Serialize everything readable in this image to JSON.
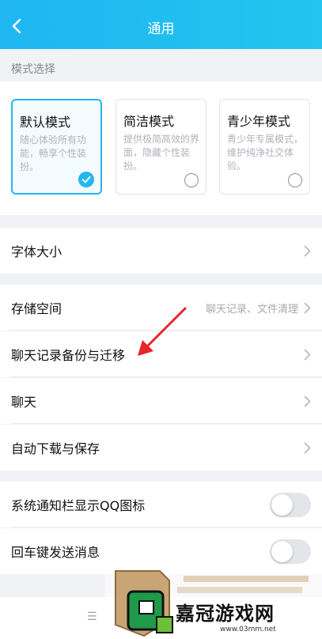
{
  "header": {
    "title": "通用"
  },
  "mode_section": {
    "label": "模式选择",
    "cards": [
      {
        "title": "默认模式",
        "desc": "随心体验所有功能，畅享个性装扮。",
        "selected": true
      },
      {
        "title": "简洁模式",
        "desc": "提供极简高效的界面，隐藏个性装扮。",
        "selected": false
      },
      {
        "title": "青少年模式",
        "desc": "青少年专属模式，维护纯净社交体验。",
        "selected": false
      }
    ]
  },
  "rows": {
    "font_size": "字体大小",
    "storage": "存储空间",
    "storage_sub": "聊天记录、文件清理",
    "chat_backup": "聊天记录备份与迁移",
    "chat": "聊天",
    "auto_download": "自动下载与保存",
    "notif_qq_icon": "系统通知栏显示QQ图标",
    "enter_send": "回车键发送消息"
  },
  "toggles": {
    "notif_qq_icon": false,
    "enter_send": false
  },
  "watermark": {
    "text": "嘉冠游戏网",
    "url": "www.03mm.net"
  },
  "colors": {
    "accent": "#23b7ef",
    "arrow": "#e8232a"
  }
}
